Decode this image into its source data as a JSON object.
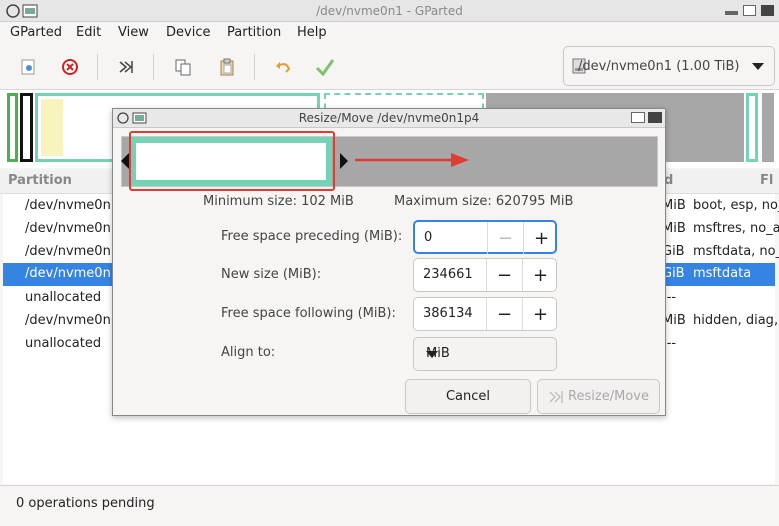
{
  "window": {
    "title": "/dev/nvme0n1 - GParted"
  },
  "menu": [
    "GParted",
    "Edit",
    "View",
    "Device",
    "Partition",
    "Help"
  ],
  "toolbar": {
    "icons": [
      "new-icon",
      "delete-icon",
      "resize-move-icon",
      "copy-icon",
      "paste-icon",
      "undo-icon",
      "apply-icon"
    ]
  },
  "device": {
    "label": "/dev/nvme0n1 (1.00 TiB)"
  },
  "table": {
    "headers": [
      "Partition",
      "d",
      "Fl"
    ],
    "rows": [
      {
        "partition": "/dev/nvme0n1",
        "size": "MiB",
        "flags": "boot, esp, no_"
      },
      {
        "partition": "/dev/nvme0n1",
        "size": "MiB",
        "flags": "msftres, no_a"
      },
      {
        "partition": "/dev/nvme0n1",
        "size": "GiB",
        "flags": "msftdata, no_"
      },
      {
        "partition": "/dev/nvme0n1",
        "size": "GiB",
        "flags": "msftdata",
        "selected": true
      },
      {
        "partition": "unallocated",
        "size": "---",
        "flags": ""
      },
      {
        "partition": "/dev/nvme0n1",
        "size": "MiB",
        "flags": "hidden, diag,"
      },
      {
        "partition": "unallocated",
        "size": "---",
        "flags": ""
      }
    ]
  },
  "status": {
    "text": "0 operations pending"
  },
  "dialog": {
    "title": "Resize/Move /dev/nvme0n1p4",
    "min_size": "Minimum size: 102 MiB",
    "max_size": "Maximum size: 620795 MiB",
    "fields": {
      "preceding": {
        "label": "Free space preceding (MiB):",
        "value": "0"
      },
      "new_size": {
        "label": "New size (MiB):",
        "value": "234661"
      },
      "following": {
        "label": "Free space following (MiB):",
        "value": "386134"
      }
    },
    "align": {
      "label": "Align to:",
      "value": "MiB"
    },
    "buttons": {
      "cancel": "Cancel",
      "resize": "Resize/Move"
    }
  },
  "colors": {
    "accent": "#3584e4",
    "partition_border": "#76d2b5",
    "highlight_red": "#e03c32",
    "unallocated_gray": "#a7a7a7"
  }
}
